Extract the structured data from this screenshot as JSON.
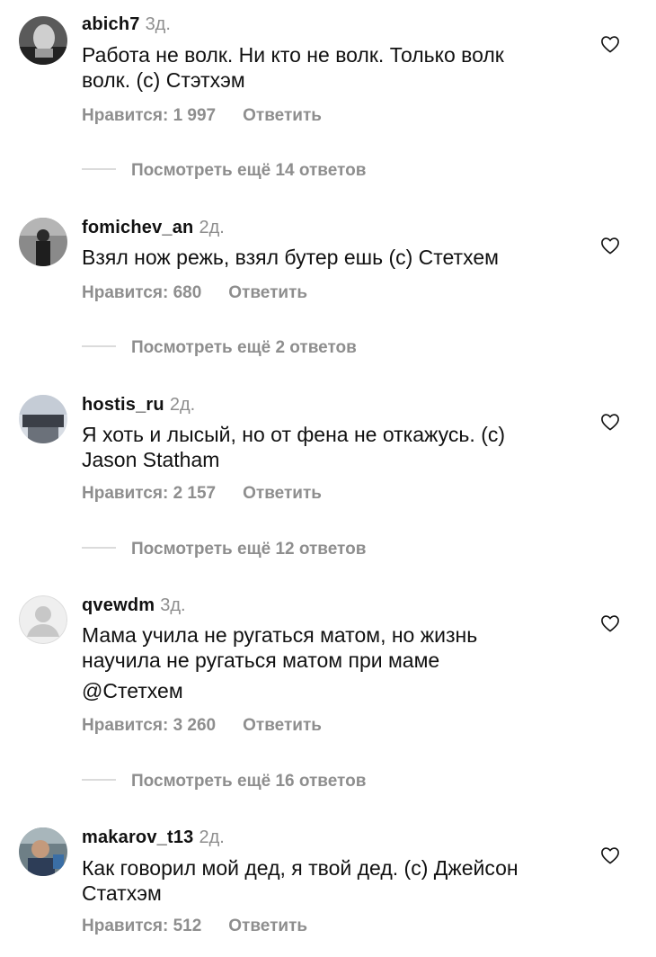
{
  "comments": [
    {
      "username": "abich7",
      "time": "3д.",
      "lines": [
        "Работа не волк. Ни кто не волк. Только волк",
        "волк. (с) Стэтхэм"
      ],
      "likes": "Нравится: 1 997",
      "reply": "Ответить",
      "more": "Посмотреть ещё 14 ответов"
    },
    {
      "username": "fomichev_an",
      "time": "2д.",
      "lines": [
        "Взял нож режь, взял бутер ешь (с) Стетхем"
      ],
      "likes": "Нравится: 680",
      "reply": "Ответить",
      "more": "Посмотреть ещё 2 ответов"
    },
    {
      "username": "hostis_ru",
      "time": "2д.",
      "lines": [
        "Я хоть и лысый, но от фена не откажусь. (с)",
        "Jason Statham"
      ],
      "likes": "Нравится: 2 157",
      "reply": "Ответить",
      "more": "Посмотреть ещё 12 ответов"
    },
    {
      "username": "qvewdm",
      "time": "3д.",
      "lines": [
        "Мама учила не ругаться матом, но жизнь",
        "научила не ругаться матом при маме"
      ],
      "mention": "@Стетхем",
      "likes": "Нравится: 3 260",
      "reply": "Ответить",
      "more": "Посмотреть ещё 16 ответов"
    },
    {
      "username": "makarov_t13",
      "time": "2д.",
      "lines": [
        "Как говорил мой дед, я твой дед. (с) Джейсон",
        "Статхэм"
      ],
      "likes": "Нравится: 512",
      "reply": "Ответить"
    }
  ],
  "colors": {
    "text": "#111111",
    "secondary": "#8e8e8e",
    "divider": "#dbdbdb"
  },
  "icons": {
    "like": "heart-outline-icon",
    "default_avatar": "default-avatar-icon"
  }
}
